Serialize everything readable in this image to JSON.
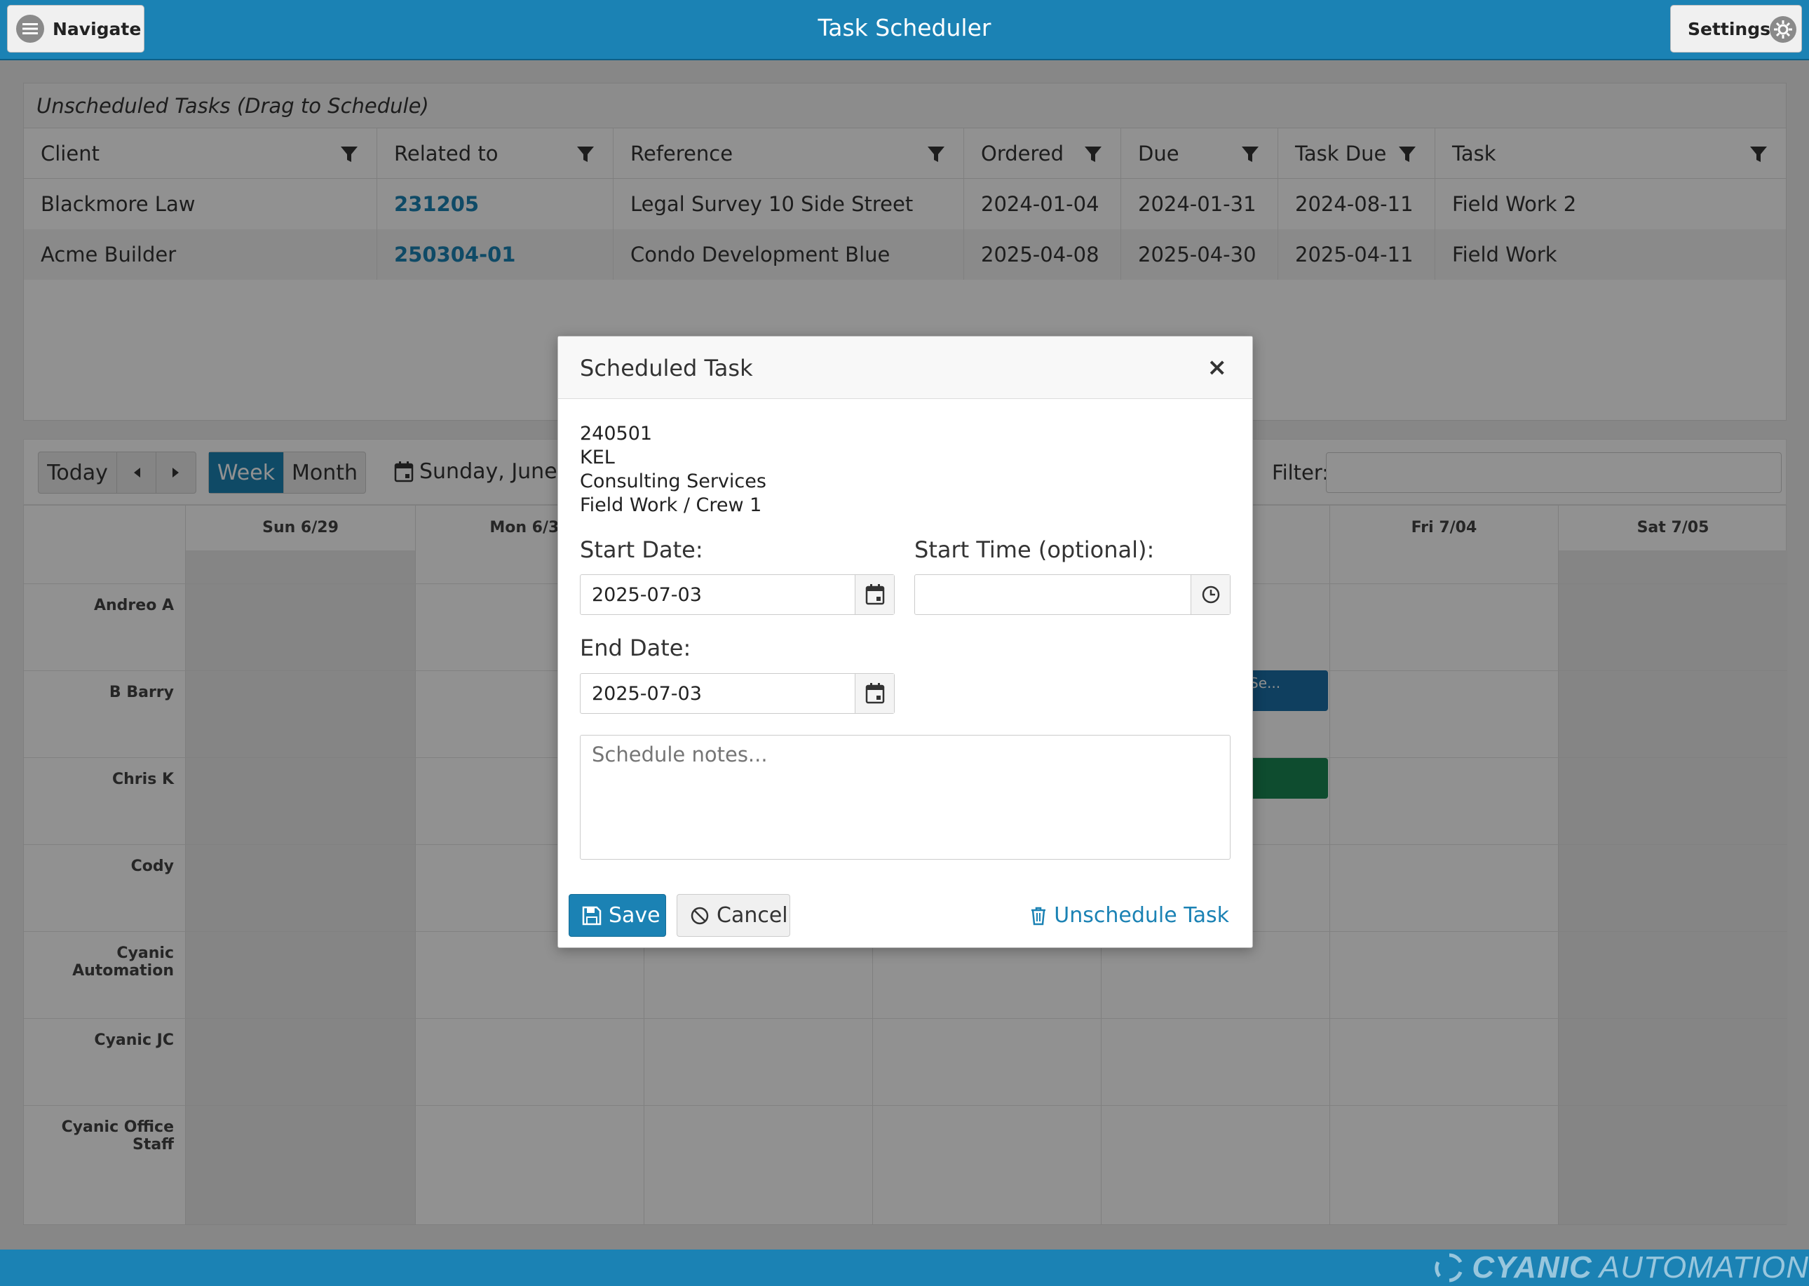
{
  "header": {
    "navigate_label": "Navigate",
    "title": "Task Scheduler",
    "settings_label": "Settings"
  },
  "unscheduled": {
    "title": "Unscheduled Tasks (Drag to Schedule)",
    "columns": [
      "Client",
      "Related to",
      "Reference",
      "Ordered",
      "Due",
      "Task Due",
      "Task"
    ],
    "rows": [
      [
        "Blackmore Law",
        "231205",
        "Legal Survey 10 Side Street",
        "2024-01-04",
        "2024-01-31",
        "2024-08-11",
        "Field Work 2"
      ],
      [
        "Acme Builder",
        "250304-01",
        "Condo Development Blue",
        "2025-04-08",
        "2025-04-30",
        "2025-04-11",
        "Field Work"
      ]
    ]
  },
  "toolbar": {
    "today_label": "Today",
    "week_label": "Week",
    "month_label": "Month",
    "date_range": "Sunday, June 29",
    "filter_label": "Filter:"
  },
  "calendar": {
    "days": [
      "Sun 6/29",
      "Mon 6/30",
      "",
      "",
      "",
      "Fri 7/04",
      "Sat 7/05"
    ],
    "resources": [
      "Andreo A",
      "B Barry",
      "Chris K",
      "Cody",
      "Cyanic Automation",
      "Cyanic JC",
      "Cyanic Office Staff"
    ],
    "event_label": "Se...",
    "colors": {
      "event_blue": "#1b6fa8",
      "event_green": "#198754"
    }
  },
  "modal": {
    "title": "Scheduled Task",
    "info_lines": [
      "240501",
      "KEL",
      "Consulting Services",
      "Field Work / Crew 1"
    ],
    "start_date_label": "Start Date:",
    "start_date": "2025-07-03",
    "start_time_label": "Start Time (optional):",
    "start_time": "",
    "end_date_label": "End Date:",
    "end_date": "2025-07-03",
    "notes_placeholder": "Schedule notes...",
    "save_label": "Save",
    "cancel_label": "Cancel",
    "unschedule_label": "Unschedule Task"
  },
  "footer": {
    "brand_primary": "CYANIC",
    "brand_secondary": "AUTOMATION"
  },
  "theme": {
    "accent": "#1b82b4"
  }
}
